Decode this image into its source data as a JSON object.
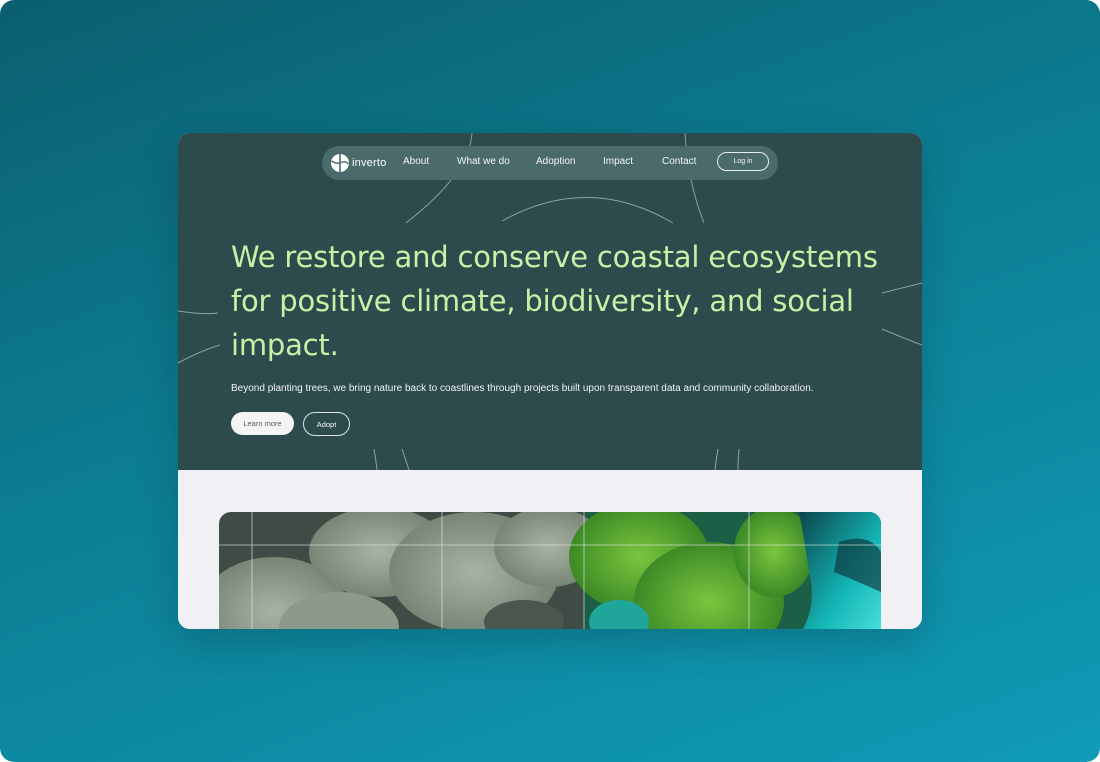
{
  "brand": {
    "name": "inverto",
    "icon": "leaf-logo-icon"
  },
  "nav": {
    "links": [
      "About",
      "What we do",
      "Adoption",
      "Impact",
      "Contact"
    ],
    "login_label": "Log in"
  },
  "hero": {
    "headline_lines": [
      "We restore and conserve coastal ecosystems",
      "for positive climate, biodiversity, and social",
      "impact."
    ],
    "subtext": "Beyond planting trees, we bring nature back to coastlines through projects built upon transparent data and community collaboration.",
    "primary_button": "Learn more",
    "secondary_button": "Adopt"
  },
  "colors": {
    "page_gradient_start": "#0b5f6f",
    "page_gradient_end": "#0f9bb7",
    "hero_background": "#2d4b4c",
    "nav_background": "#4a6a6b",
    "headline": "#c5f2a6",
    "lower_background": "#f1f0f4"
  }
}
